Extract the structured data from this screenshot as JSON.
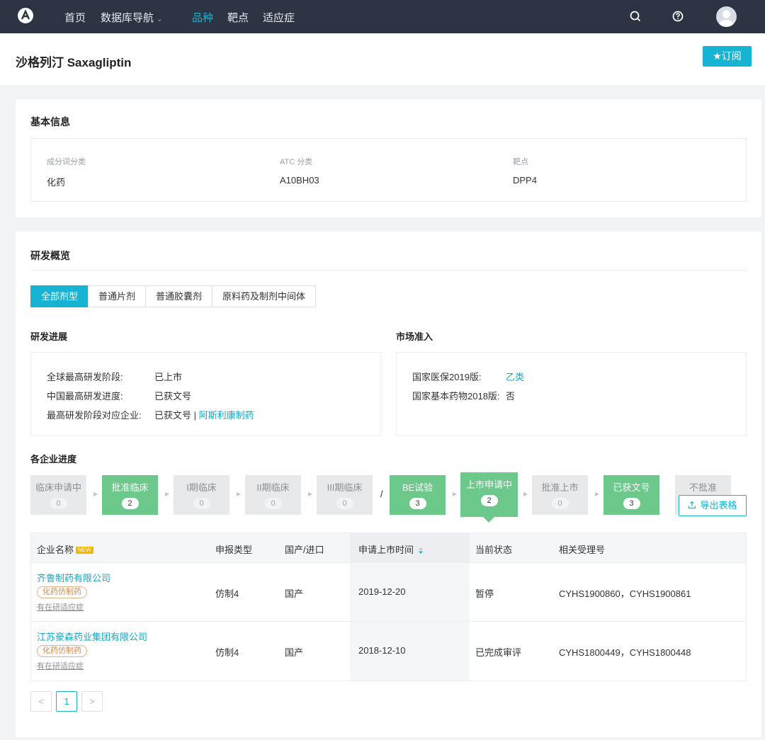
{
  "nav": {
    "items": [
      "首页",
      "数据库导航",
      "品种",
      "靶点",
      "适应症"
    ]
  },
  "header": {
    "title": "沙格列汀 Saxagliptin",
    "subscribe_label": "★订阅"
  },
  "basic_info": {
    "title": "基本信息",
    "fields": [
      {
        "label": "成分词分类",
        "value": "化药"
      },
      {
        "label": "ATC 分类",
        "value": "A10BH03"
      },
      {
        "label": "靶点",
        "value": "DPP4"
      }
    ]
  },
  "rd": {
    "title": "研发概览",
    "tabs": [
      "全部剂型",
      "普通片剂",
      "普通胶囊剂",
      "原料药及制剂中间体"
    ],
    "progress": {
      "title": "研发进展",
      "rows": [
        {
          "key": "全球最高研发阶段:",
          "value": "已上市"
        },
        {
          "key": "中国最高研发进度:",
          "value": "已获文号"
        },
        {
          "key": "最高研发阶段对应企业:",
          "value": "已获文号 |",
          "link": "阿斯利康制药"
        }
      ]
    },
    "market": {
      "title": "市场准入",
      "rows": [
        {
          "key": "国家医保2019版:",
          "value": "乙类"
        },
        {
          "key": "国家基本药物2018版:",
          "value": "否"
        }
      ]
    },
    "enterprise_title": "各企业进度",
    "stages": [
      {
        "name": "临床申请中",
        "count": "0"
      },
      {
        "name": "批准临床",
        "count": "2"
      },
      {
        "name": "I期临床",
        "count": "0"
      },
      {
        "name": "II期临床",
        "count": "0"
      },
      {
        "name": "III期临床",
        "count": "0"
      },
      {
        "name": "BE试验",
        "count": "3"
      },
      {
        "name": "上市申请中",
        "count": "2"
      },
      {
        "name": "批准上市",
        "count": "0"
      },
      {
        "name": "已获文号",
        "count": "3"
      },
      {
        "name": "不批准",
        "count": ""
      }
    ],
    "slash": "/",
    "export_label": "导出表格",
    "table": {
      "headers": [
        "企业名称",
        "申报类型",
        "国产/进口",
        "申请上市时间",
        "当前状态",
        "相关受理号"
      ],
      "new_badge": "NEW",
      "rows": [
        {
          "company": "齐鲁制药有限公司",
          "tag": "化药仿制药",
          "sub": "有在研适应症",
          "type": "仿制4",
          "origin": "国产",
          "date": "2019-12-20",
          "status": "暂停",
          "numbers": "CYHS1900860，CYHS1900861"
        },
        {
          "company": "江苏豪森药业集团有限公司",
          "tag": "化药仿制药",
          "sub": "有在研适应症",
          "type": "仿制4",
          "origin": "国产",
          "date": "2018-12-10",
          "status": "已完成审评",
          "numbers": "CYHS1800449，CYHS1800448"
        }
      ]
    },
    "pagination": {
      "prev": "<",
      "current": "1",
      "next": ">"
    }
  }
}
